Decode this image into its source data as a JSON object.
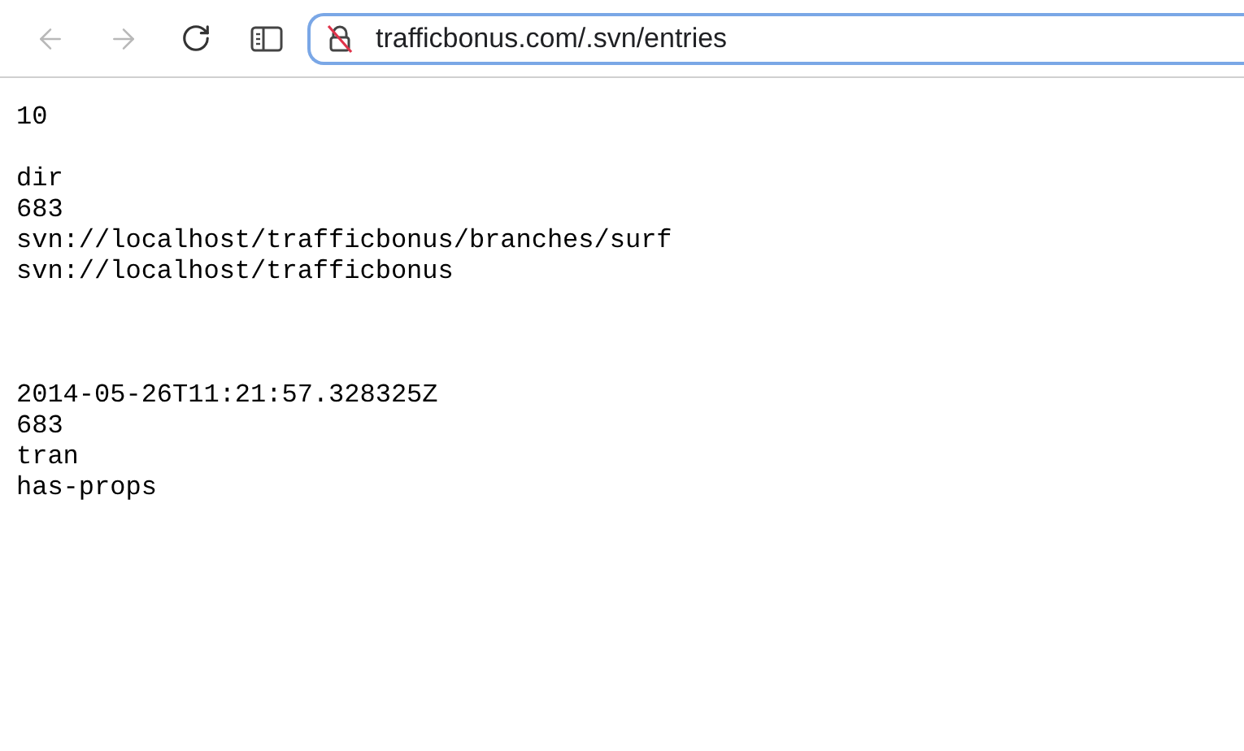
{
  "toolbar": {
    "back": {
      "disabled": true
    },
    "forward": {
      "disabled": true
    },
    "address_bar": {
      "value": "trafficbonus.com/.svn/entries",
      "focused": true,
      "secure": false
    }
  },
  "page_lines": [
    {
      "kind": "text",
      "text": "10"
    },
    {
      "kind": "blank"
    },
    {
      "kind": "text",
      "text": "dir"
    },
    {
      "kind": "text",
      "text": "683"
    },
    {
      "kind": "text",
      "text": "svn://localhost/trafficbonus/branches/surf"
    },
    {
      "kind": "text",
      "text": "svn://localhost/trafficbonus"
    },
    {
      "kind": "blank"
    },
    {
      "kind": "blank"
    },
    {
      "kind": "blank"
    },
    {
      "kind": "text",
      "text": "2014-05-26T11:21:57.328325Z"
    },
    {
      "kind": "text",
      "text": "683"
    },
    {
      "kind": "text",
      "text": "tran"
    },
    {
      "kind": "text",
      "text": "has-props"
    }
  ]
}
